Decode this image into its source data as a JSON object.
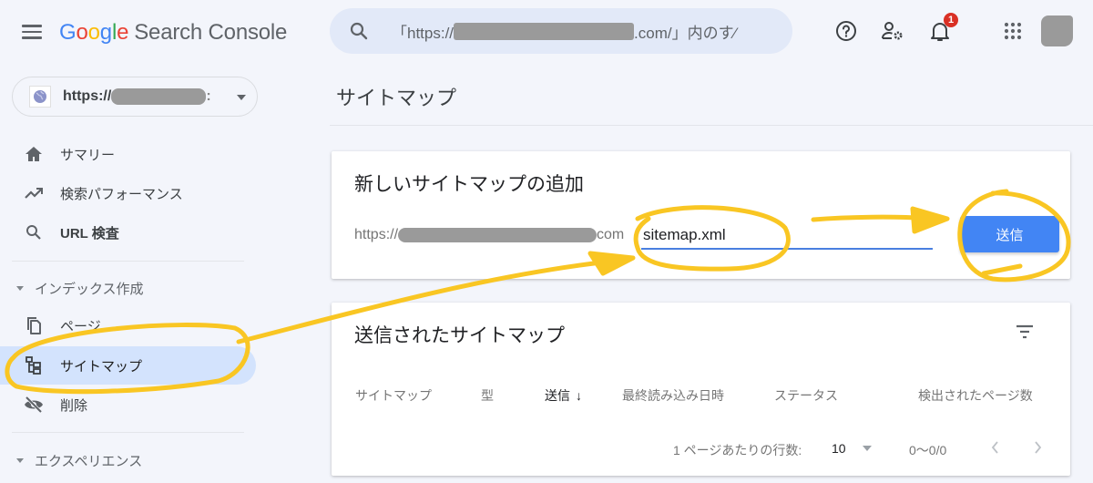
{
  "header": {
    "logo_google": [
      "G",
      "o",
      "o",
      "g",
      "l",
      "e"
    ],
    "product_name": "Search Console",
    "search_prefix": "「https://",
    "search_suffix": ".com/」内のす⁄",
    "notification_count": "1",
    "icons": [
      "menu-icon",
      "search-icon",
      "help-icon",
      "manage-users-icon",
      "notifications-icon",
      "apps-icon",
      "avatar"
    ]
  },
  "sidebar": {
    "property_prefix": "https://",
    "property_suffix": ":",
    "items": [
      {
        "label": "サマリー",
        "icon": "home-icon"
      },
      {
        "label": "検索パフォーマンス",
        "icon": "trending-up-icon"
      },
      {
        "label": "URL 検査",
        "icon": "search-icon"
      }
    ],
    "sections": [
      {
        "label": "インデックス作成",
        "items": [
          {
            "label": "ページ",
            "icon": "pages-icon"
          },
          {
            "label": "サイトマップ",
            "icon": "sitemap-icon",
            "active": true
          },
          {
            "label": "削除",
            "icon": "visibility-off-icon"
          }
        ]
      },
      {
        "label": "エクスペリエンス",
        "items": []
      }
    ]
  },
  "main": {
    "page_title": "サイトマップ",
    "add_card": {
      "title": "新しいサイトマップの追加",
      "url_prefix": "https://",
      "url_suffix": "com",
      "input_value": "sitemap.xml",
      "submit_label": "送信"
    },
    "submitted_card": {
      "title": "送信されたサイトマップ",
      "columns": [
        "サイトマップ",
        "型",
        "送信",
        "最終読み込み日時",
        "ステータス",
        "検出されたページ数"
      ],
      "sorted_column": "送信",
      "rows": [],
      "rows_per_page_label": "1 ページあたりの行数:",
      "rows_per_page_value": "10",
      "range_label": "0〜0/0"
    }
  },
  "colors": {
    "accent": "#4285f4",
    "active_nav": "#d3e3fd",
    "annotation": "#f9c623",
    "background": "#f3f5fb"
  }
}
